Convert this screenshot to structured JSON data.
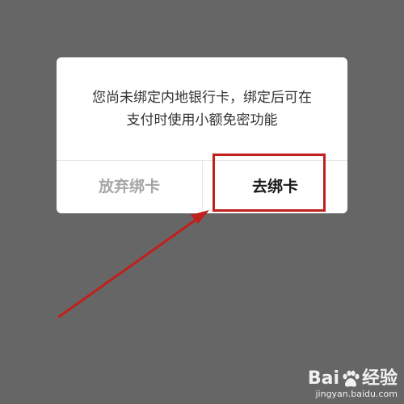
{
  "dialog": {
    "message_line1": "您尚未绑定内地银行卡，绑定后可在",
    "message_line2": "支付时使用小额免密功能",
    "cancel_label": "放弃绑卡",
    "confirm_label": "去绑卡"
  },
  "annotation": {
    "highlight_color": "#c0201e"
  },
  "watermark": {
    "logo_text_left": "Bai",
    "logo_text_right": "经验",
    "url": "jingyan.baidu.com"
  }
}
